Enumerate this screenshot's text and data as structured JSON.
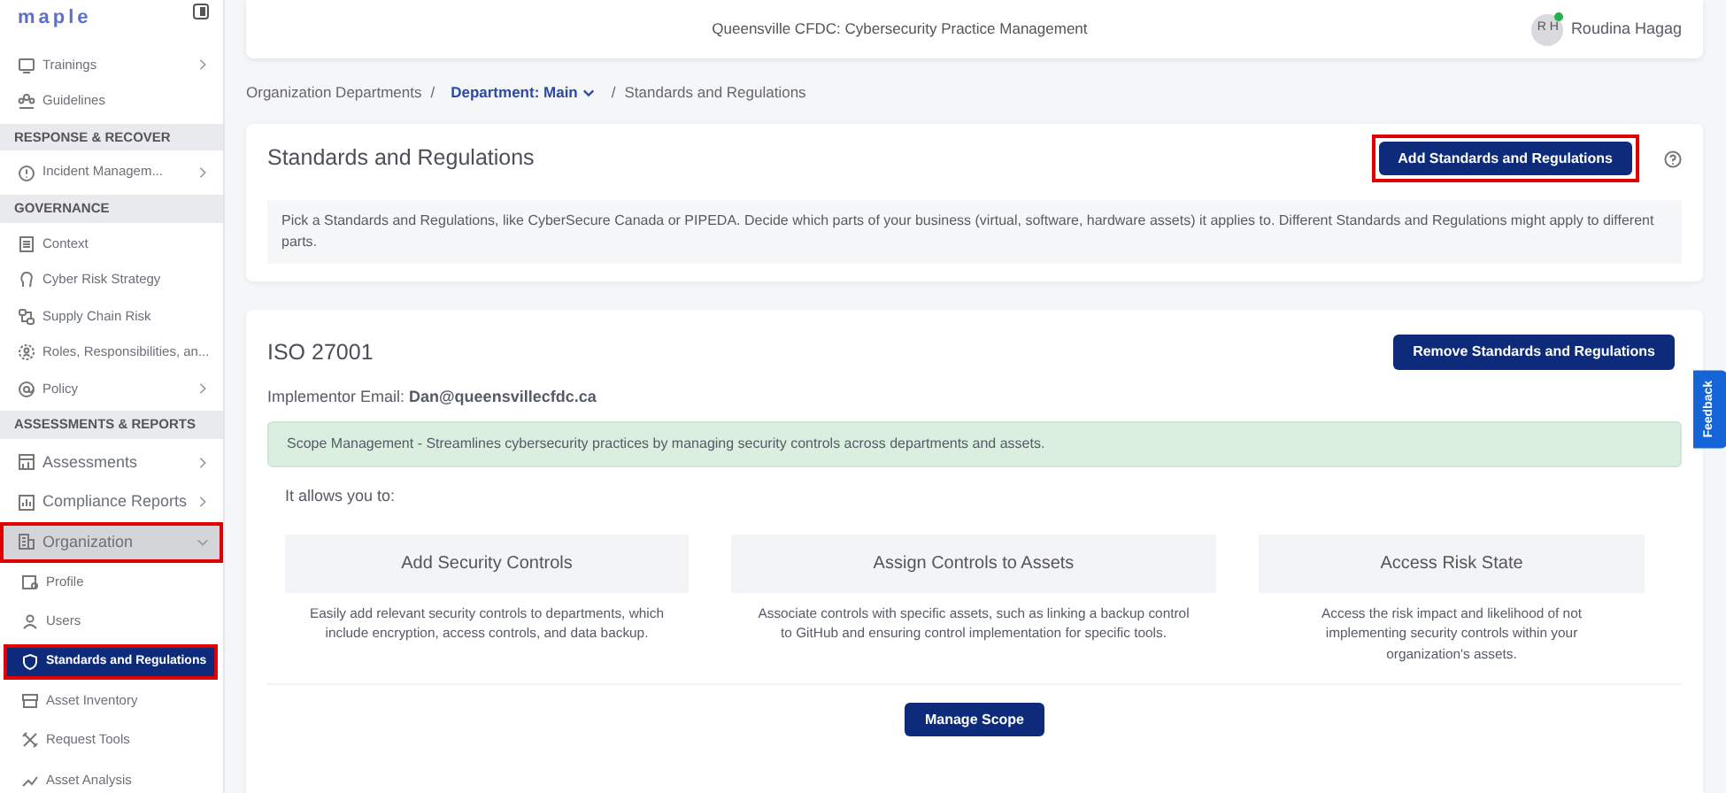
{
  "sidebar": {
    "logo": "maple",
    "items": [
      {
        "kind": "item",
        "label": "Trainings",
        "expanded": false,
        "selected": false,
        "highlighted": false
      },
      {
        "kind": "item",
        "label": "Guidelines",
        "selected": false,
        "highlighted": false
      },
      {
        "kind": "section",
        "label": "RESPONSE & RECOVER"
      },
      {
        "kind": "item",
        "label": "Incident Managem...",
        "expanded": false,
        "selected": false,
        "highlighted": false
      },
      {
        "kind": "section",
        "label": "GOVERNANCE"
      },
      {
        "kind": "item",
        "label": "Context",
        "selected": false,
        "highlighted": false
      },
      {
        "kind": "item",
        "label": "Cyber Risk Strategy",
        "selected": false,
        "highlighted": false
      },
      {
        "kind": "item",
        "label": "Supply Chain Risk",
        "selected": false,
        "highlighted": false
      },
      {
        "kind": "item",
        "label": "Roles, Responsibilities, an...",
        "selected": false,
        "highlighted": false
      },
      {
        "kind": "item",
        "label": "Policy",
        "expanded": false,
        "selected": false,
        "highlighted": false
      },
      {
        "kind": "section",
        "label": "ASSESSMENTS & REPORTS"
      },
      {
        "kind": "item",
        "label": "Assessments",
        "expanded": false,
        "selected": false,
        "highlighted": false
      },
      {
        "kind": "item",
        "label": "Compliance Reports",
        "expanded": false,
        "selected": false,
        "highlighted": false
      },
      {
        "kind": "item",
        "label": "Organization",
        "expanded": true,
        "selected": false,
        "highlighted": true,
        "children": [
          {
            "label": "Profile",
            "selected": false,
            "highlighted": false
          },
          {
            "label": "Users",
            "selected": false,
            "highlighted": false
          },
          {
            "label": "Standards and Regulations",
            "selected": true,
            "highlighted": true
          },
          {
            "label": "Asset Inventory",
            "selected": false,
            "highlighted": false
          },
          {
            "label": "Request Tools",
            "selected": false,
            "highlighted": false
          },
          {
            "label": "Asset Analysis",
            "selected": false,
            "highlighted": false
          }
        ]
      }
    ]
  },
  "header": {
    "title": "Queensville CFDC: Cybersecurity Practice Management",
    "avatar": "R H",
    "online": true,
    "user": "Roudina Hagag"
  },
  "breadcrumb": {
    "separator": "/",
    "items": [
      {
        "label": "Organization Departments",
        "kind": "link"
      },
      {
        "label": "Department: Main",
        "kind": "dropdown"
      },
      {
        "label": "Standards and Regulations",
        "kind": "current"
      }
    ]
  },
  "intro_card": {
    "title": "Standards and Regulations",
    "button": {
      "label": "Add Standards and Regulations",
      "highlighted": true
    },
    "description": "Pick a Standards and Regulations, like CyberSecure Canada or PIPEDA. Decide which parts of your business (virtual, software, hardware assets) it applies to. Different Standards and Regulations might apply to different parts."
  },
  "standard_card": {
    "title": "ISO 27001",
    "button": {
      "label": "Remove Standards and Regulations",
      "highlighted": false
    },
    "implementor": "Implementor Email: **Dan@queensvillecfdc.ca**",
    "alert": "Scope Management - Streamlines cybersecurity practices by managing security controls across departments and assets.",
    "intro": "It allows you to:",
    "features": [
      {
        "title": "Add Security Controls",
        "description": "Easily add relevant security controls to departments, which include encryption, access controls, and data backup."
      },
      {
        "title": "Assign Controls to Assets",
        "description": "Associate controls with specific assets, such as linking a backup control to GitHub and ensuring control implementation for specific tools."
      },
      {
        "title": "Access Risk State",
        "description": "Access the risk impact and likelihood of not implementing security controls within your organization's assets."
      }
    ],
    "action": "Manage Scope"
  },
  "feedback_tab": "Feedback"
}
